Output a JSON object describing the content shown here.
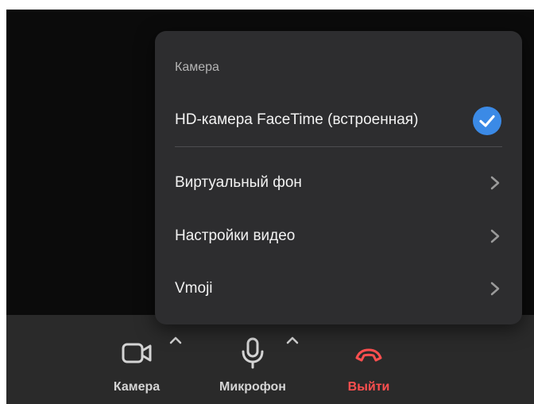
{
  "menu": {
    "heading": "Камера",
    "camera_option": "HD-камера FaceTime (встроенная)",
    "items": [
      {
        "label": "Виртуальный фон"
      },
      {
        "label": "Настройки видео"
      },
      {
        "label": "Vmoji"
      }
    ]
  },
  "toolbar": {
    "camera_label": "Камера",
    "mic_label": "Микрофон",
    "leave_label": "Выйти"
  },
  "colors": {
    "accent": "#3b8ae6",
    "leave": "#ff4f4f",
    "background": "#0b0b0b",
    "panel": "#2d2d2f",
    "toolbar": "#2a2a2a"
  },
  "icons": [
    "camera-icon",
    "microphone-icon",
    "hang-up-icon",
    "chevron-up-icon",
    "chevron-right-icon",
    "checkmark-icon"
  ]
}
